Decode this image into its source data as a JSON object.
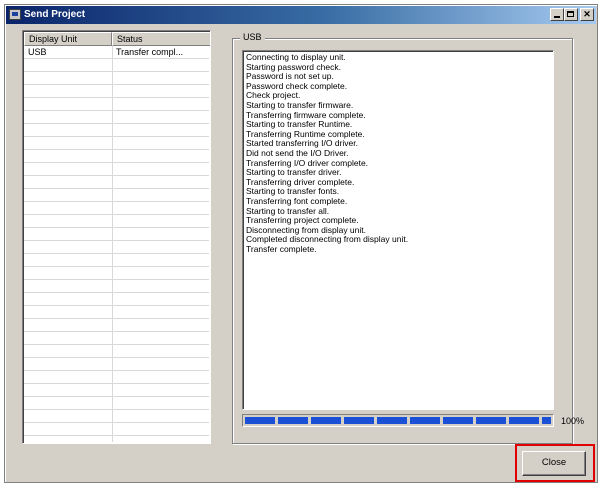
{
  "window": {
    "title": "Send Project"
  },
  "list": {
    "columns": [
      "Display Unit",
      "Status"
    ],
    "rows": [
      {
        "unit": "USB",
        "status": "Transfer compl..."
      }
    ],
    "empty_row_count": 30
  },
  "log": {
    "group_label": "USB",
    "lines": [
      "Connecting to display unit.",
      "Starting password check.",
      "Password is not set up.",
      "Password check complete.",
      "Check project.",
      "Starting to transfer firmware.",
      "Transferring firmware complete.",
      "Starting to transfer Runtime.",
      "Transferring Runtime complete.",
      "Started transferring I/O driver.",
      "Did not send the I/O Driver.",
      "Transferring I/O driver complete.",
      "Starting to transfer driver.",
      "Transferring driver complete.",
      "Starting to transfer fonts.",
      "Transferring font complete.",
      "Starting to transfer all.",
      "Transferring project complete.",
      "Disconnecting from display unit.",
      "Completed disconnecting from display unit.",
      "Transfer complete."
    ]
  },
  "progress": {
    "value": 100,
    "label": "100%"
  },
  "buttons": {
    "close_label": "Close"
  },
  "colors": {
    "progress": "#1a4fd6",
    "highlight": "#e00000",
    "title_bar": "#0a246a"
  },
  "icons": [
    "app-icon",
    "minimize-icon",
    "maximize-icon",
    "close-icon"
  ]
}
